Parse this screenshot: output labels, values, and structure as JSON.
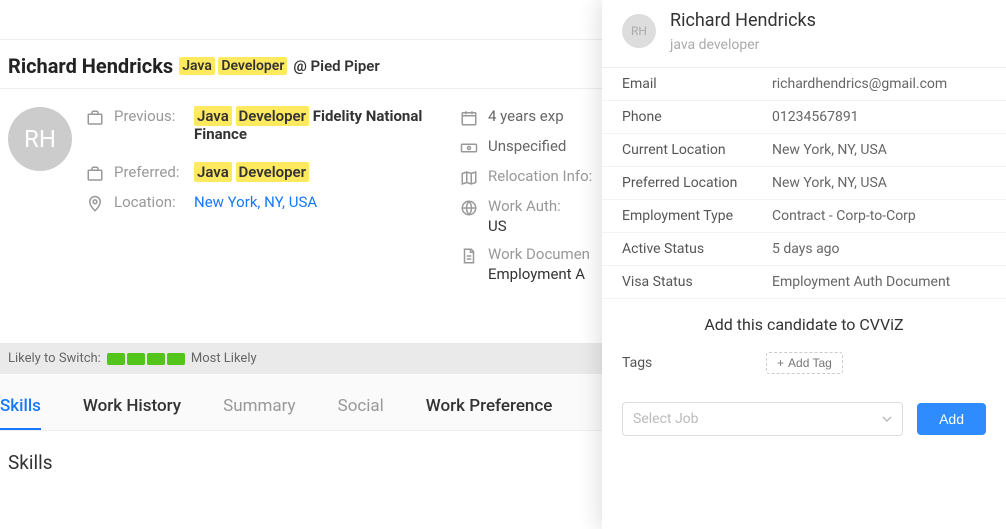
{
  "profile": {
    "name": "Richard Hendricks",
    "title_hl1": "Java",
    "title_hl2": "Developer",
    "at_prefix": "@",
    "company": "Pied Piper",
    "avatar_initials": "RH"
  },
  "info_left": {
    "previous_label": "Previous:",
    "previous_hl1": "Java",
    "previous_hl2": "Developer",
    "previous_company": "Fidelity National Finance",
    "preferred_label": "Preferred:",
    "preferred_hl1": "Java",
    "preferred_hl2": "Developer",
    "location_label": "Location:",
    "location_value": "New York, NY, USA"
  },
  "info_right": {
    "experience": "4 years exp",
    "salary": "Unspecified",
    "relocation_label": "Relocation Info:",
    "workauth_label": "Work Auth:",
    "workauth_value": "US",
    "workdoc_label": "Work Documen",
    "workdoc_value": "Employment A"
  },
  "switch": {
    "prefix": "Likely to Switch:",
    "suffix": "Most Likely"
  },
  "tabs": [
    {
      "label": "Skills",
      "active": true,
      "emph": true
    },
    {
      "label": "Work History",
      "active": false,
      "emph": true
    },
    {
      "label": "Summary",
      "active": false,
      "emph": false
    },
    {
      "label": "Social",
      "active": false,
      "emph": false
    },
    {
      "label": "Work Preference",
      "active": false,
      "emph": true
    }
  ],
  "section_title": "Skills",
  "side": {
    "name": "Richard Hendricks",
    "role": "java developer",
    "avatar_initials": "RH",
    "rows": [
      {
        "label": "Email",
        "value": "richardhendrics@gmail.com"
      },
      {
        "label": "Phone",
        "value": "01234567891"
      },
      {
        "label": "Current Location",
        "value": "New York, NY, USA"
      },
      {
        "label": "Preferred Location",
        "value": "New York, NY, USA"
      },
      {
        "label": "Employment Type",
        "value": "Contract - Corp-to-Corp"
      },
      {
        "label": "Active Status",
        "value": "5 days ago"
      },
      {
        "label": "Visa Status",
        "value": "Employment Auth Document"
      }
    ],
    "cta": "Add this candidate to CVViZ",
    "tags_label": "Tags",
    "add_tag_label": "Add Tag",
    "select_job_placeholder": "Select Job",
    "add_button": "Add"
  }
}
